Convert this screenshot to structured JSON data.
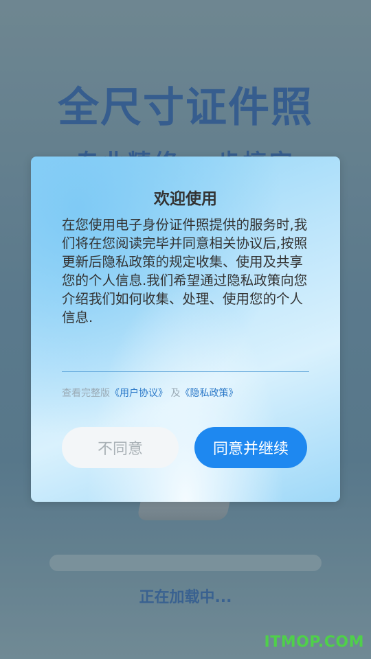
{
  "background": {
    "title": "全尺寸证件照",
    "subtitle": "专业精修 一步搞定",
    "loading_text": "正在加载中...",
    "progress": 0
  },
  "dialog": {
    "title": "欢迎使用",
    "body": "在您使用电子身份证件照提供的服务时,我们将在您阅读完毕并同意相关协议后,按照更新后隐私政策的规定收集、使用及共享您的个人信息.我们希望通过隐私政策向您介绍我们如何收集、处理、使用您的个人信息.",
    "links": {
      "prefix": "查看完整版",
      "user_agreement": "《用户协议》",
      "and": "及",
      "privacy_policy": "《隐私政策》"
    },
    "disagree_label": "不同意",
    "agree_label": "同意并继续"
  },
  "watermark": "ITMOP.COM",
  "colors": {
    "accent": "#1e88f0",
    "title_blue": "#1a4a8c",
    "watermark_green": "#4fd04a"
  }
}
